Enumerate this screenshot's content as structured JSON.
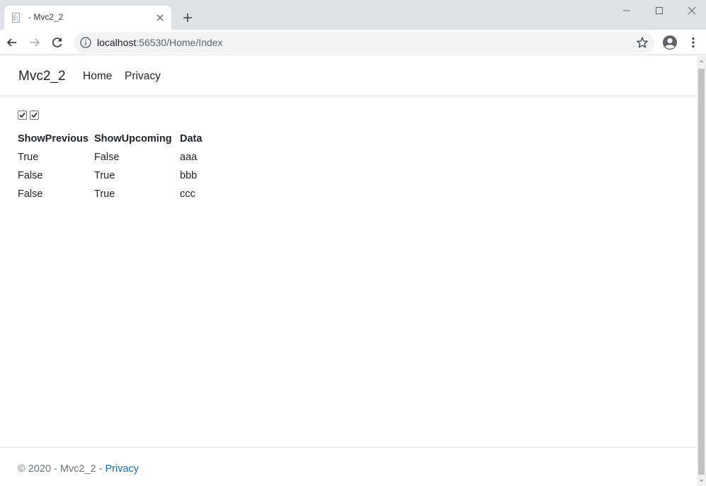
{
  "browser": {
    "tab_title": "- Mvc2_2",
    "url_host": "localhost",
    "url_rest": ":56530/Home/Index"
  },
  "site": {
    "brand": "Mvc2_2",
    "nav": [
      "Home",
      "Privacy"
    ]
  },
  "filters": {
    "show_previous_checked": true,
    "show_upcoming_checked": true
  },
  "table": {
    "headers": [
      "ShowPrevious",
      "ShowUpcoming",
      "Data"
    ],
    "rows": [
      [
        "True",
        "False",
        "aaa"
      ],
      [
        "False",
        "True",
        "bbb"
      ],
      [
        "False",
        "True",
        "ccc"
      ]
    ]
  },
  "footer": {
    "text": "© 2020 - Mvc2_2 - ",
    "link": "Privacy"
  },
  "colors": {
    "link": "#1b6ec2",
    "chrome_bg": "#dee1e6"
  }
}
